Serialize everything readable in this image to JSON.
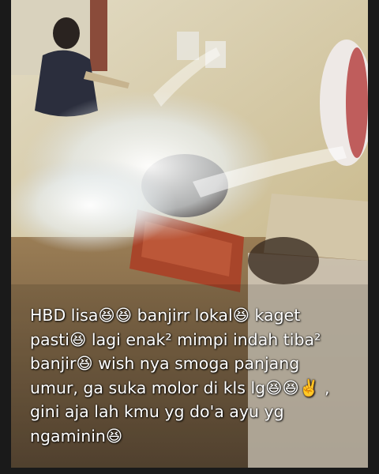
{
  "photo": {
    "subject_icon": "water-splash-photo"
  },
  "caption": {
    "line1": "HBD lisa😆😆 banjirr lokal😆 kaget",
    "line2": "pasti😆 lagi enak² mimpi indah tiba²",
    "line3": "banjir😆 wish nya smoga panjang",
    "line4": "umur,  ga suka molor di kls lg😆😆✌️ ,",
    "line5": "gini aja lah kmu yg do'a ayu yg",
    "line6": "ngaminin😆"
  }
}
